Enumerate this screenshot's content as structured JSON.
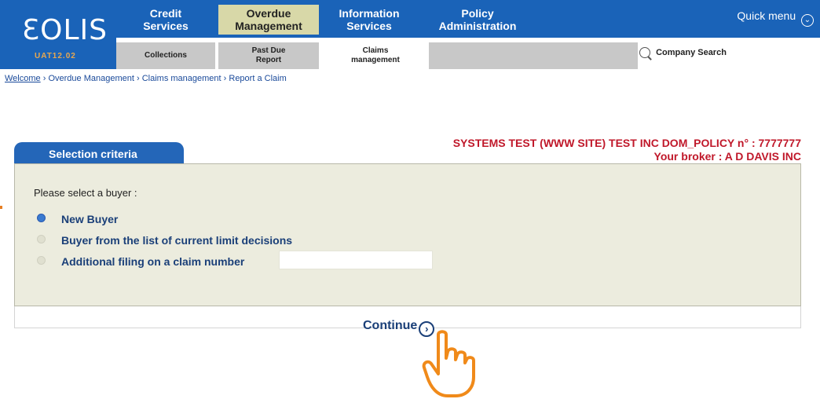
{
  "logo": {
    "text": "ƐOLIS",
    "version": "UAT12.02"
  },
  "topnav": {
    "tabs": [
      {
        "line1": "Credit",
        "line2": "Services"
      },
      {
        "line1": "Overdue",
        "line2": "Management"
      },
      {
        "line1": "Information",
        "line2": "Services"
      },
      {
        "line1": "Policy",
        "line2": "Administration"
      }
    ],
    "quick_menu": "Quick menu"
  },
  "subnav": {
    "tabs": [
      {
        "line1": "Collections",
        "line2": ""
      },
      {
        "line1": "Past Due",
        "line2": "Report"
      },
      {
        "line1": "Claims",
        "line2": "management"
      }
    ],
    "company_search": "Company Search"
  },
  "breadcrumb": {
    "items": [
      "Welcome",
      "Overdue Management",
      "Claims management",
      "Report a Claim"
    ],
    "separator": "›"
  },
  "policy": {
    "line1": "SYSTEMS TEST (WWW SITE) TEST INC DOM_POLICY n° : 7777777",
    "line2": "Your broker : A D DAVIS INC"
  },
  "panel": {
    "tab_label": "Selection criteria",
    "prompt": "Please select a buyer :",
    "options": [
      {
        "label": "New Buyer",
        "selected": true
      },
      {
        "label": "Buyer from the list of current limit decisions",
        "selected": false
      },
      {
        "label": "Additional filing on a claim number",
        "selected": false
      }
    ],
    "claim_number_value": ""
  },
  "continue_label": "Continue",
  "colors": {
    "brand_blue": "#1a63b8",
    "active_tab": "#d8d8a8",
    "policy_red": "#c0182a",
    "panel_bg": "#ececde",
    "hand": "#f08a1a"
  }
}
